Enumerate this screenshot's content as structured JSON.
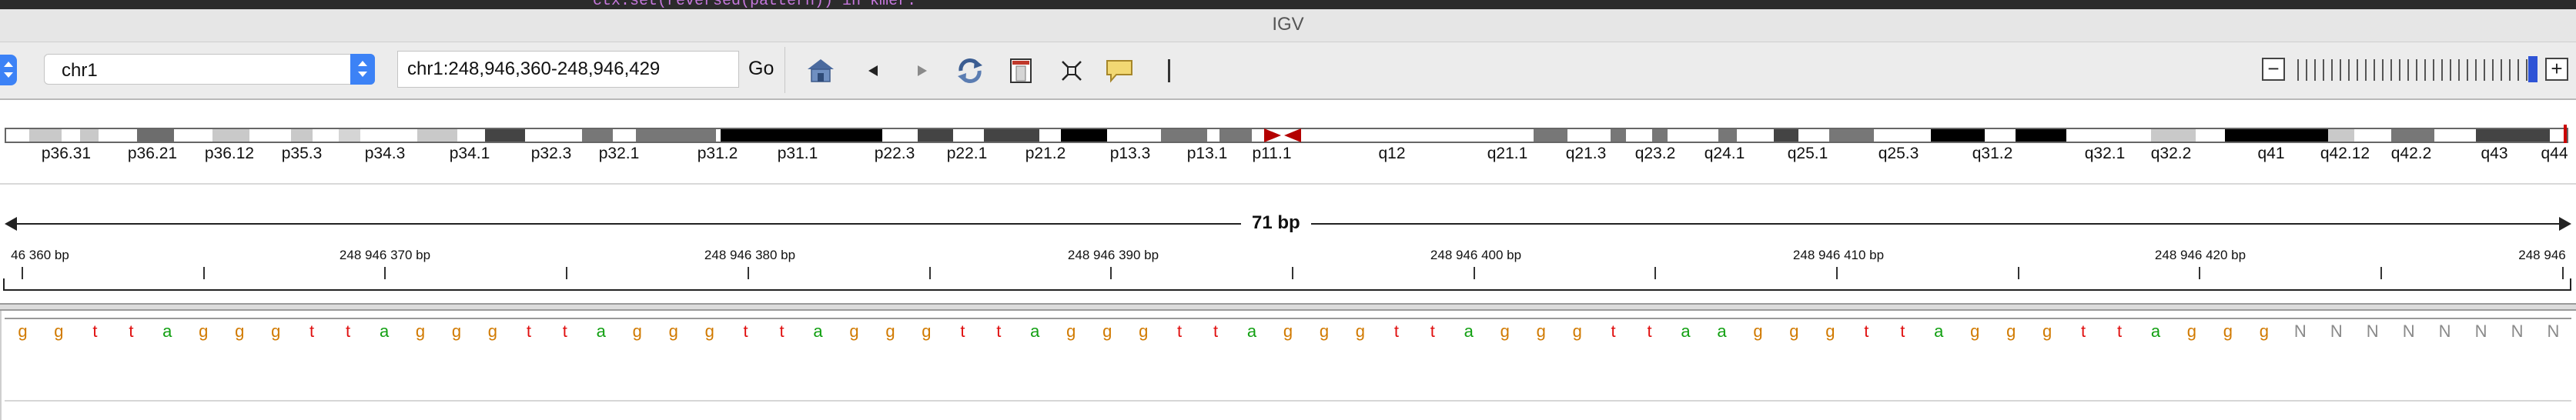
{
  "editor_snippet": "ctx.set(reversed(pattern)) in kmer:",
  "window": {
    "title": "IGV"
  },
  "toolbar": {
    "chromosome": "chr1",
    "locus": "chr1:248,946,360-248,946,429",
    "go_label": "Go",
    "zoom_minus": "−",
    "zoom_plus": "+",
    "zoom_level_fraction": 0.97
  },
  "ideogram": {
    "band_labels": [
      "p36.31",
      "p36.21",
      "p36.12",
      "p35.3",
      "p34.3",
      "p34.1",
      "p32.3",
      "p32.1",
      "p31.2",
      "p31.1",
      "p22.3",
      "p22.1",
      "p21.2",
      "p13.3",
      "p13.1",
      "p11.1",
      "q12",
      "q21.1",
      "q21.3",
      "q23.2",
      "q24.1",
      "q25.1",
      "q25.3",
      "q31.2",
      "q32.1",
      "q32.2",
      "q41",
      "q42.12",
      "q42.2",
      "q43",
      "q44"
    ],
    "current_position_color": "#cc0000",
    "centromere_color": "#b40000"
  },
  "ruler": {
    "span": "71 bp",
    "tick_labels": [
      "46 360 bp",
      "248 946 370 bp",
      "248 946 380 bp",
      "248 946 390 bp",
      "248 946 400 bp",
      "248 946 410 bp",
      "248 946 420 bp",
      "248 946"
    ]
  },
  "sequence": {
    "bases": [
      "g",
      "g",
      "t",
      "t",
      "a",
      "g",
      "g",
      "g",
      "t",
      "t",
      "a",
      "g",
      "g",
      "g",
      "t",
      "t",
      "a",
      "g",
      "g",
      "g",
      "t",
      "t",
      "a",
      "g",
      "g",
      "g",
      "t",
      "t",
      "a",
      "g",
      "g",
      "g",
      "t",
      "t",
      "a",
      "g",
      "g",
      "g",
      "t",
      "t",
      "a",
      "g",
      "g",
      "g",
      "t",
      "t",
      "a",
      "a",
      "g",
      "g",
      "g",
      "t",
      "t",
      "a",
      "g",
      "g",
      "g",
      "t",
      "t",
      "a",
      "g",
      "g",
      "g",
      "N",
      "N",
      "N",
      "N",
      "N",
      "N",
      "N",
      "N"
    ],
    "colors": {
      "a": "#12a012",
      "c": "#1f3fd0",
      "g": "#d17a00",
      "t": "#e01010",
      "N": "#8a8a8a"
    }
  }
}
